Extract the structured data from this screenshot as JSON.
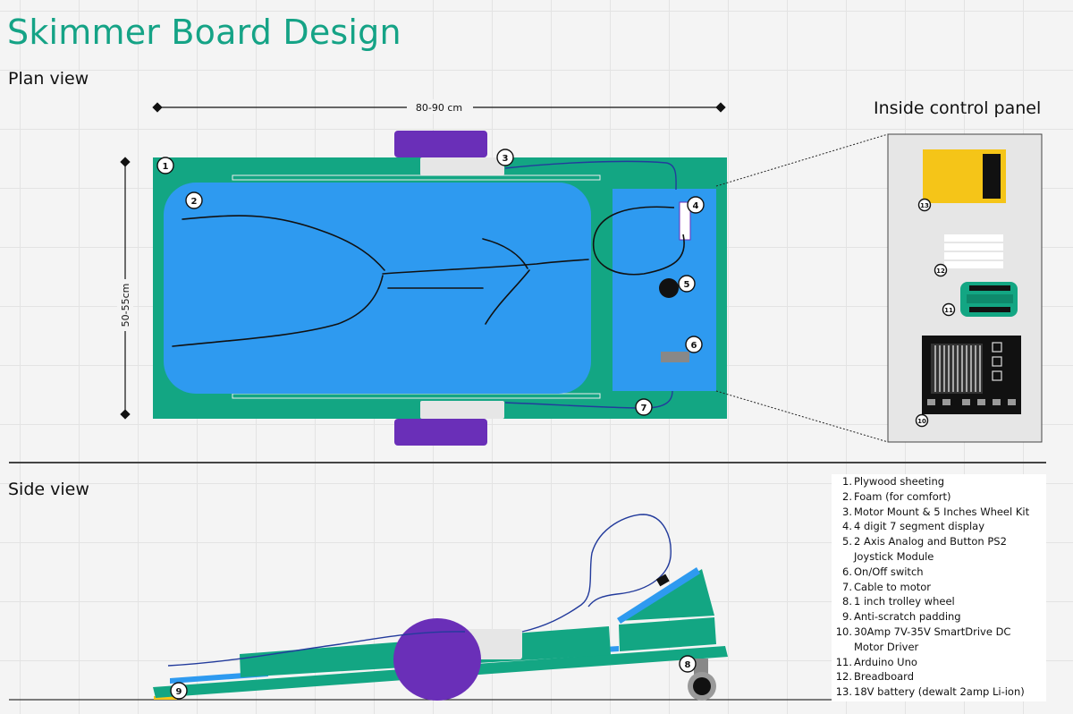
{
  "title": "Skimmer Board Design",
  "plan_view_label": "Plan view",
  "side_view_label": "Side view",
  "control_panel_label": "Inside control panel",
  "dimensions": {
    "length": "80-90 cm",
    "width": "50-55cm"
  },
  "colors": {
    "title": "#15a386",
    "plywood": "#13a683",
    "foam": "#2e9af0",
    "wheel": "#6a2fb8",
    "mount": "#e6e6e6",
    "battery": "#f5c518",
    "cable": "#233b9c"
  },
  "callouts": [
    "1",
    "2",
    "3",
    "4",
    "5",
    "6",
    "7",
    "8",
    "9",
    "10",
    "11",
    "12",
    "13"
  ],
  "legend": [
    {
      "num": "1.",
      "text": "Plywood sheeting"
    },
    {
      "num": "2.",
      "text": "Foam (for comfort)"
    },
    {
      "num": "3.",
      "text": "Motor Mount & 5 Inches Wheel Kit"
    },
    {
      "num": "4.",
      "text": "4 digit 7 segment display"
    },
    {
      "num": "5.",
      "text": "2 Axis Analog and Button PS2 Joystick Module"
    },
    {
      "num": "6.",
      "text": "On/Off switch"
    },
    {
      "num": "7.",
      "text": "Cable to motor"
    },
    {
      "num": "8.",
      "text": "1 inch trolley wheel"
    },
    {
      "num": "9.",
      "text": "Anti-scratch padding"
    },
    {
      "num": "10.",
      "text": "30Amp 7V-35V SmartDrive DC Motor Driver"
    },
    {
      "num": "11.",
      "text": "Arduino Uno"
    },
    {
      "num": "12.",
      "text": "Breadboard"
    },
    {
      "num": "13.",
      "text": "18V battery (dewalt 2amp Li-ion)"
    }
  ]
}
